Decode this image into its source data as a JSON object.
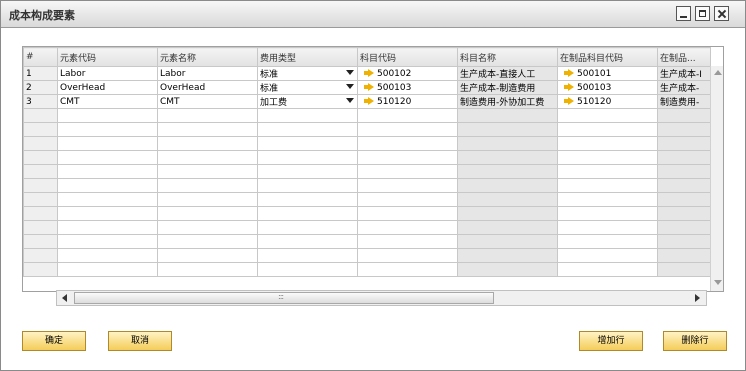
{
  "window": {
    "title": "成本构成要素"
  },
  "grid": {
    "headers": [
      "#",
      "元素代码",
      "元素名称",
      "费用类型",
      "科目代码",
      "科目名称",
      "在制品科目代码",
      "在制品..."
    ],
    "rows": [
      {
        "num": "1",
        "code": "Labor",
        "name": "Labor",
        "type": "标准",
        "acct": "500102",
        "acct_name": "生产成本-直接人工",
        "wip": "500101",
        "wip_name": "生产成本-I"
      },
      {
        "num": "2",
        "code": "OverHead",
        "name": "OverHead",
        "type": "标准",
        "acct": "500103",
        "acct_name": "生产成本-制造费用",
        "wip": "500103",
        "wip_name": "生产成本-"
      },
      {
        "num": "3",
        "code": "CMT",
        "name": "CMT",
        "type": "加工费",
        "acct": "510120",
        "acct_name": "制造费用-外协加工费",
        "wip": "510120",
        "wip_name": "制造费用-"
      }
    ]
  },
  "buttons": {
    "ok": "确定",
    "cancel": "取消",
    "add_row": "增加行",
    "delete_row": "删除行"
  },
  "colors": {
    "button_fill": "#f4cd5a",
    "link_arrow": "#f0b200"
  }
}
